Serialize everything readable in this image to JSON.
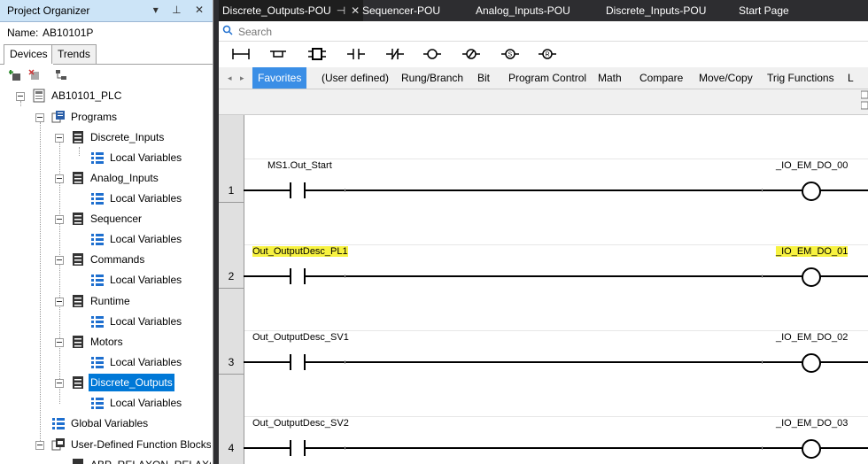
{
  "organizer": {
    "title": "Project Organizer",
    "title_buttons": "▾ ⊥ ✕",
    "name_label": "Name:",
    "name_value": "AB10101P",
    "tabs": [
      "Devices",
      "Trends"
    ],
    "tree": {
      "root": "AB10101_PLC",
      "programs": "Programs",
      "items": [
        {
          "label": "Discrete_Inputs",
          "child": "Local Variables"
        },
        {
          "label": "Analog_Inputs",
          "child": "Local Variables"
        },
        {
          "label": "Sequencer",
          "child": "Local Variables"
        },
        {
          "label": "Commands",
          "child": "Local Variables"
        },
        {
          "label": "Runtime",
          "child": "Local Variables"
        },
        {
          "label": "Motors",
          "child": "Local Variables"
        },
        {
          "label": "Discrete_Outputs",
          "child": "Local Variables"
        }
      ],
      "global_vars": "Global Variables",
      "udfb": "User-Defined Function Blocks",
      "udfb_child": "ABP_RELAXON_RELAXOFF"
    }
  },
  "doc_tabs": [
    {
      "label": "Discrete_Outputs-POU",
      "active": true
    },
    {
      "label": "Sequencer-POU"
    },
    {
      "label": "Analog_Inputs-POU"
    },
    {
      "label": "Discrete_Inputs-POU"
    },
    {
      "label": "Start Page"
    }
  ],
  "search": {
    "placeholder": "Search"
  },
  "categories": [
    "Favorites",
    "(User defined)",
    "Rung/Branch",
    "Bit",
    "Program Control",
    "Math",
    "Compare",
    "Move/Copy",
    "Trig Functions",
    "L"
  ],
  "rungs": [
    {
      "number": "1",
      "contact": "MS1.Out_Start",
      "coil": "_IO_EM_DO_00",
      "highlight": false
    },
    {
      "number": "2",
      "contact": "Out_OutputDesc_PL1",
      "coil": "_IO_EM_DO_01",
      "highlight": true
    },
    {
      "number": "3",
      "contact": "Out_OutputDesc_SV1",
      "coil": "_IO_EM_DO_02",
      "highlight": false
    },
    {
      "number": "4",
      "contact": "Out_OutputDesc_SV2",
      "coil": "_IO_EM_DO_03",
      "highlight": false
    }
  ],
  "colors": {
    "accent": "#3a8ee6",
    "selection": "#0078d7",
    "highlight": "#f7f240",
    "titlebar": "#cce4f7"
  },
  "icons": [
    "new-program-icon",
    "delete-icon",
    "tree-view-icon",
    "plc-icon",
    "programs-icon",
    "pou-icon",
    "variables-icon",
    "fb-icon"
  ]
}
